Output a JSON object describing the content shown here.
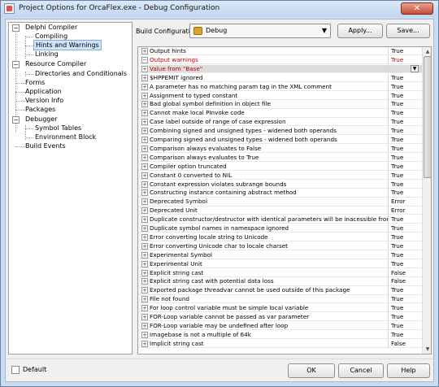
{
  "window": {
    "title": "Project Options for OrcaFlex.exe - Debug Configuration",
    "close_glyph": "✕"
  },
  "tree": {
    "delphi_compiler": "Delphi Compiler",
    "compiling": "Compiling",
    "hints_and_warnings": "Hints and Warnings",
    "linking": "Linking",
    "resource_compiler": "Resource Compiler",
    "directories_and_conditionals": "Directories and Conditionals",
    "forms": "Forms",
    "application": "Application",
    "version_info": "Version Info",
    "packages": "Packages",
    "debugger": "Debugger",
    "symbol_tables": "Symbol Tables",
    "environment_block": "Environment Block",
    "build_events": "Build Events"
  },
  "build_configuration": {
    "label": "Build Configuration",
    "value": "Debug",
    "apply_label": "Apply...",
    "save_label": "Save..."
  },
  "grid": {
    "rows": [
      {
        "box": "+",
        "name": "Output hints",
        "value": "True",
        "style": ""
      },
      {
        "box": "−",
        "name": "Output warnings",
        "value": "True",
        "style": "red"
      },
      {
        "box": "+",
        "name": "Value from \"Base\"",
        "value": "",
        "style": "red hl",
        "marker": "»"
      },
      {
        "box": "+",
        "name": "$HPPEMIT ignored",
        "value": "True",
        "style": ""
      },
      {
        "box": "+",
        "name": "A parameter has no matching param tag in the XML comment",
        "value": "True",
        "style": ""
      },
      {
        "box": "+",
        "name": "Assignment to typed constant",
        "value": "True",
        "style": ""
      },
      {
        "box": "+",
        "name": "Bad global symbol definition in object file",
        "value": "True",
        "style": ""
      },
      {
        "box": "+",
        "name": "Cannot make local PInvoke code",
        "value": "True",
        "style": ""
      },
      {
        "box": "+",
        "name": "Case label outside of range of case expression",
        "value": "True",
        "style": ""
      },
      {
        "box": "+",
        "name": "Combining signed and unsigned types - widened both operands",
        "value": "True",
        "style": ""
      },
      {
        "box": "+",
        "name": "Comparing signed and unsigned types - widened both operands",
        "value": "True",
        "style": ""
      },
      {
        "box": "+",
        "name": "Comparison always evaluates to False",
        "value": "True",
        "style": ""
      },
      {
        "box": "+",
        "name": "Comparison always evaluates to True",
        "value": "True",
        "style": ""
      },
      {
        "box": "+",
        "name": "Compiler option truncated",
        "value": "True",
        "style": ""
      },
      {
        "box": "+",
        "name": "Constant 0 converted to NIL",
        "value": "True",
        "style": ""
      },
      {
        "box": "+",
        "name": "Constant expression violates subrange bounds",
        "value": "True",
        "style": ""
      },
      {
        "box": "+",
        "name": "Constructing instance containing abstract method",
        "value": "True",
        "style": ""
      },
      {
        "box": "+",
        "name": "Deprecated Symbol",
        "value": "Error",
        "style": ""
      },
      {
        "box": "+",
        "name": "Deprecated Unit",
        "value": "Error",
        "style": ""
      },
      {
        "box": "+",
        "name": "Duplicate constructor/destructor with identical parameters will be inacessible from C++",
        "value": "True",
        "style": ""
      },
      {
        "box": "+",
        "name": "Duplicate symbol names in namespace ignored",
        "value": "True",
        "style": ""
      },
      {
        "box": "+",
        "name": "Error converting locale string to Unicode",
        "value": "True",
        "style": ""
      },
      {
        "box": "+",
        "name": "Error converting Unicode char to locale charset",
        "value": "True",
        "style": ""
      },
      {
        "box": "+",
        "name": "Experimental Symbol",
        "value": "True",
        "style": ""
      },
      {
        "box": "+",
        "name": "Experimental Unit",
        "value": "True",
        "style": ""
      },
      {
        "box": "+",
        "name": "Explicit string cast",
        "value": "False",
        "style": ""
      },
      {
        "box": "+",
        "name": "Explicit string cast with potential data loss",
        "value": "False",
        "style": ""
      },
      {
        "box": "+",
        "name": "Exported package threadvar cannot be used outside of this package",
        "value": "True",
        "style": ""
      },
      {
        "box": "+",
        "name": "File not found",
        "value": "True",
        "style": ""
      },
      {
        "box": "+",
        "name": "For loop control variable must be simple local variable",
        "value": "True",
        "style": ""
      },
      {
        "box": "+",
        "name": "FOR-Loop variable cannot be passed as var parameter",
        "value": "True",
        "style": ""
      },
      {
        "box": "+",
        "name": "FOR-Loop variable may be undefined after loop",
        "value": "True",
        "style": ""
      },
      {
        "box": "+",
        "name": "Imagebase is not a multiple of 64k",
        "value": "True",
        "style": ""
      },
      {
        "box": "+",
        "name": "Implicit string cast",
        "value": "False",
        "style": ""
      }
    ]
  },
  "footer": {
    "default_label": "Default",
    "ok_label": "OK",
    "cancel_label": "Cancel",
    "help_label": "Help"
  }
}
